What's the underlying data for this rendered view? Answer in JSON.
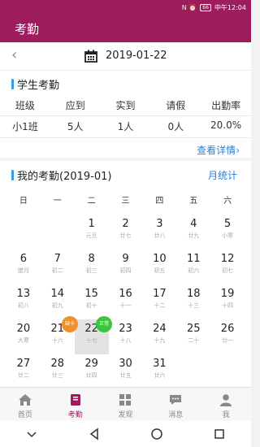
{
  "status_bar": {
    "icons_text": "N ⏰",
    "battery": "66",
    "time": "中午12:04"
  },
  "app_title": "考勤",
  "date_bar": {
    "date": "2019-01-22"
  },
  "student_section": {
    "title": "学生考勤",
    "headers": [
      "班级",
      "应到",
      "实到",
      "请假",
      "出勤率"
    ],
    "values": [
      "小1班",
      "5人",
      "1人",
      "0人",
      "20.0%"
    ],
    "detail_link": "查看详情"
  },
  "my_section": {
    "title": "我的考勤(2019-01)",
    "month_stat": "月统计",
    "weekdays": [
      "日",
      "一",
      "二",
      "三",
      "四",
      "五",
      "六"
    ],
    "days": [
      {
        "n": "",
        "l": ""
      },
      {
        "n": "",
        "l": ""
      },
      {
        "n": "1",
        "l": "元旦"
      },
      {
        "n": "2",
        "l": "廿七"
      },
      {
        "n": "3",
        "l": "廿八"
      },
      {
        "n": "4",
        "l": "廿九"
      },
      {
        "n": "5",
        "l": "小寒"
      },
      {
        "n": "6",
        "l": "腊月"
      },
      {
        "n": "7",
        "l": "初二"
      },
      {
        "n": "8",
        "l": "初三"
      },
      {
        "n": "9",
        "l": "初四"
      },
      {
        "n": "10",
        "l": "初五"
      },
      {
        "n": "11",
        "l": "初六"
      },
      {
        "n": "12",
        "l": "初七"
      },
      {
        "n": "13",
        "l": "初八"
      },
      {
        "n": "14",
        "l": "初九"
      },
      {
        "n": "15",
        "l": "初十"
      },
      {
        "n": "16",
        "l": "十一"
      },
      {
        "n": "17",
        "l": "十二"
      },
      {
        "n": "18",
        "l": "十三"
      },
      {
        "n": "19",
        "l": "十四"
      },
      {
        "n": "20",
        "l": "大寒"
      },
      {
        "n": "21",
        "l": "十六"
      },
      {
        "n": "22",
        "l": "十七"
      },
      {
        "n": "23",
        "l": "十八"
      },
      {
        "n": "24",
        "l": "十九"
      },
      {
        "n": "25",
        "l": "二十"
      },
      {
        "n": "26",
        "l": "廿一"
      },
      {
        "n": "27",
        "l": "廿二"
      },
      {
        "n": "28",
        "l": "廿三"
      },
      {
        "n": "29",
        "l": "廿四"
      },
      {
        "n": "30",
        "l": "廿五"
      },
      {
        "n": "31",
        "l": "廿六"
      }
    ],
    "selected_day": "22",
    "badge_late": "缺卡",
    "badge_ok": "正常"
  },
  "tabs": [
    {
      "label": "首页",
      "icon": "home-icon"
    },
    {
      "label": "考勤",
      "icon": "book-icon"
    },
    {
      "label": "发现",
      "icon": "grid-icon"
    },
    {
      "label": "消息",
      "icon": "chat-icon"
    },
    {
      "label": "我",
      "icon": "person-icon"
    }
  ],
  "colors": {
    "brand": "#9c1c5c",
    "accent": "#2aa4e8",
    "link": "#2a7fd6",
    "late": "#f0902a",
    "ok": "#3cc43c"
  }
}
